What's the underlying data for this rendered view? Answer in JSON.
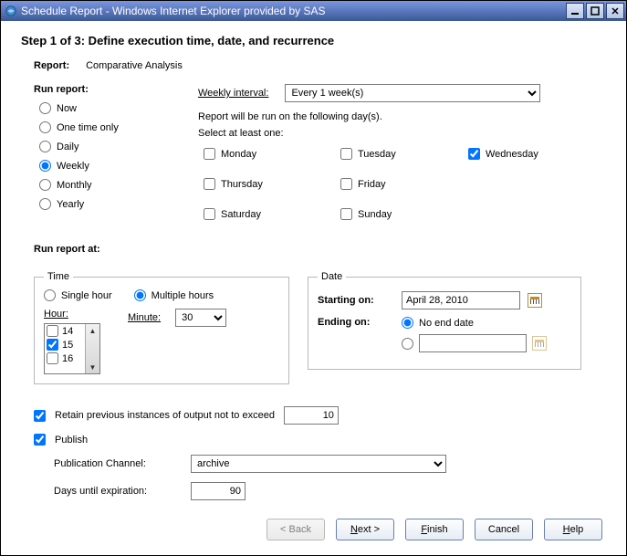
{
  "window": {
    "title": "Schedule Report - Windows Internet Explorer provided by SAS"
  },
  "step": {
    "heading": "Step 1 of 3: Define execution time, date, and recurrence"
  },
  "report": {
    "label": "Report:",
    "name": "Comparative Analysis"
  },
  "runReport": {
    "heading": "Run report:",
    "options": {
      "now": "Now",
      "onetime": "One time only",
      "daily": "Daily",
      "weekly": "Weekly",
      "monthly": "Monthly",
      "yearly": "Yearly"
    },
    "selected": "weekly"
  },
  "weekly": {
    "intervalLabel": "Weekly interval:",
    "intervalValue": "Every 1 week(s)",
    "runOnText": "Report will be run on the following day(s).",
    "selectText": "Select at least one:",
    "days": {
      "mon": "Monday",
      "tue": "Tuesday",
      "wed": "Wednesday",
      "thu": "Thursday",
      "fri": "Friday",
      "sat": "Saturday",
      "sun": "Sunday"
    },
    "checked": [
      "wed"
    ]
  },
  "runAt": {
    "heading": "Run report at:",
    "timeLegend": "Time",
    "singleHour": "Single hour",
    "multipleHours": "Multiple hours",
    "timeMode": "multiple",
    "hourLabel": "Hour:",
    "hours": [
      {
        "h": "14",
        "checked": false
      },
      {
        "h": "15",
        "checked": true
      },
      {
        "h": "16",
        "checked": false
      }
    ],
    "minuteLabel": "Minute:",
    "minuteValue": "30",
    "dateLegend": "Date",
    "startingLabel": "Starting on:",
    "startingValue": "April 28, 2010",
    "endingLabel": "Ending on:",
    "noEndLabel": "No end date",
    "endingMode": "noend",
    "endingValue": ""
  },
  "retain": {
    "checked": true,
    "label": "Retain previous instances of output not to exceed",
    "value": "10"
  },
  "publish": {
    "checked": true,
    "label": "Publish",
    "channelLabel": "Publication Channel:",
    "channelValue": "archive",
    "expireLabel": "Days until expiration:",
    "expireValue": "90"
  },
  "buttons": {
    "back": "< Back",
    "next": "Next >",
    "finish": "Finish",
    "cancel": "Cancel",
    "help": "Help"
  }
}
